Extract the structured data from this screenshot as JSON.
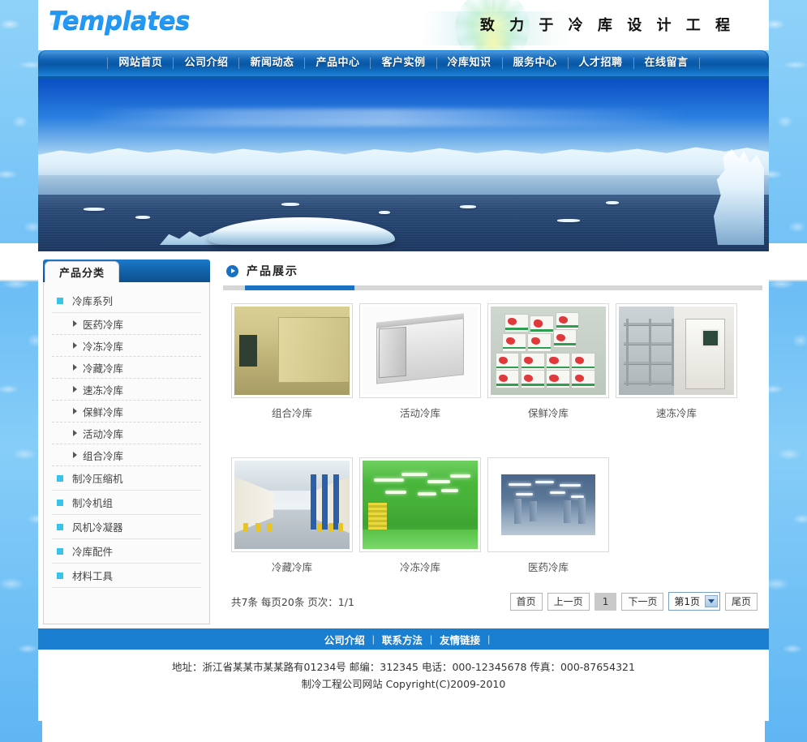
{
  "header": {
    "logo": "Templates",
    "slogan": "致 力 于 冷 库 设 计 工 程"
  },
  "nav": {
    "items": [
      "网站首页",
      "公司介绍",
      "新闻动态",
      "产品中心",
      "客户实例",
      "冷库知识",
      "服务中心",
      "人才招聘",
      "在线留言"
    ]
  },
  "banner": {
    "alt": "冰川海景横幅"
  },
  "sidebar": {
    "tab_label": "产品分类",
    "categories": [
      {
        "label": "冷库系列",
        "subs": [
          "医药冷库",
          "冷冻冷库",
          "冷藏冷库",
          "速冻冷库",
          "保鲜冷库",
          "活动冷库",
          "组合冷库"
        ]
      },
      {
        "label": "制冷压缩机",
        "subs": []
      },
      {
        "label": "制冷机组",
        "subs": []
      },
      {
        "label": "风机冷凝器",
        "subs": []
      },
      {
        "label": "冷库配件",
        "subs": []
      },
      {
        "label": "材料工具",
        "subs": []
      }
    ]
  },
  "main": {
    "title": "产品展示",
    "products": [
      {
        "caption": "组合冷库",
        "style": "combined"
      },
      {
        "caption": "活动冷库",
        "style": "mobile"
      },
      {
        "caption": "保鲜冷库",
        "style": "boxes"
      },
      {
        "caption": "速冻冷库",
        "style": "quick"
      },
      {
        "caption": "冷藏冷库",
        "style": "corridor"
      },
      {
        "caption": "冷冻冷库",
        "style": "green"
      },
      {
        "caption": "医药冷库",
        "style": "pharma"
      }
    ]
  },
  "pager": {
    "info": "共7条 每页20条 页次：1/1",
    "first": "首页",
    "prev": "上一页",
    "current": "1",
    "next": "下一页",
    "select_value": "第1页",
    "last": "尾页"
  },
  "footer": {
    "links": [
      "公司介绍",
      "联系方法",
      "友情链接"
    ],
    "separator": "|",
    "address": "地址：浙江省某某市某某路有01234号 邮编：312345 电话：000-12345678 传真：000-87654321",
    "copyright": "制冷工程公司网站 Copyright(C)2009-2010"
  },
  "colors": {
    "nav_blue": "#0a58a6",
    "accent_blue": "#1a7fd0",
    "cyan_square": "#37c4e8",
    "ice_bg": "#73c5f7"
  }
}
